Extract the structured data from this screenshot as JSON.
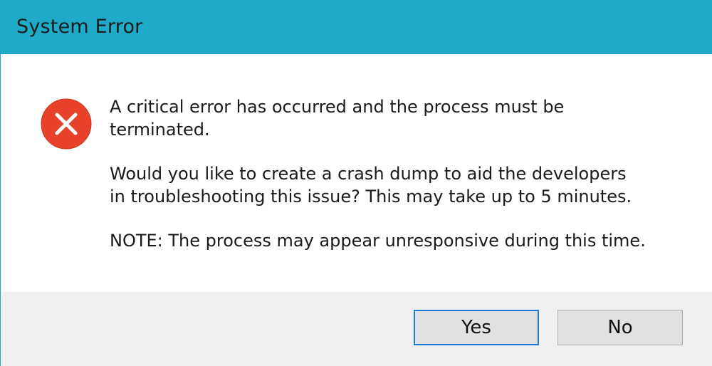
{
  "window": {
    "title": "System Error"
  },
  "icon": {
    "name": "error-icon",
    "color": "#e8432a"
  },
  "message": {
    "line1": "A critical error has occurred and the process must be\nterminated.",
    "line2": "Would you like to create a crash dump to aid the developers\nin troubleshooting this issue? This may take up to 5 minutes.",
    "line3": "NOTE: The process may appear unresponsive during this time."
  },
  "buttons": {
    "yes_label": "Yes",
    "no_label": "No"
  },
  "colors": {
    "titlebar": "#1eaac8",
    "footer": "#f0f0f0",
    "default_button_border": "#1a78d4"
  }
}
